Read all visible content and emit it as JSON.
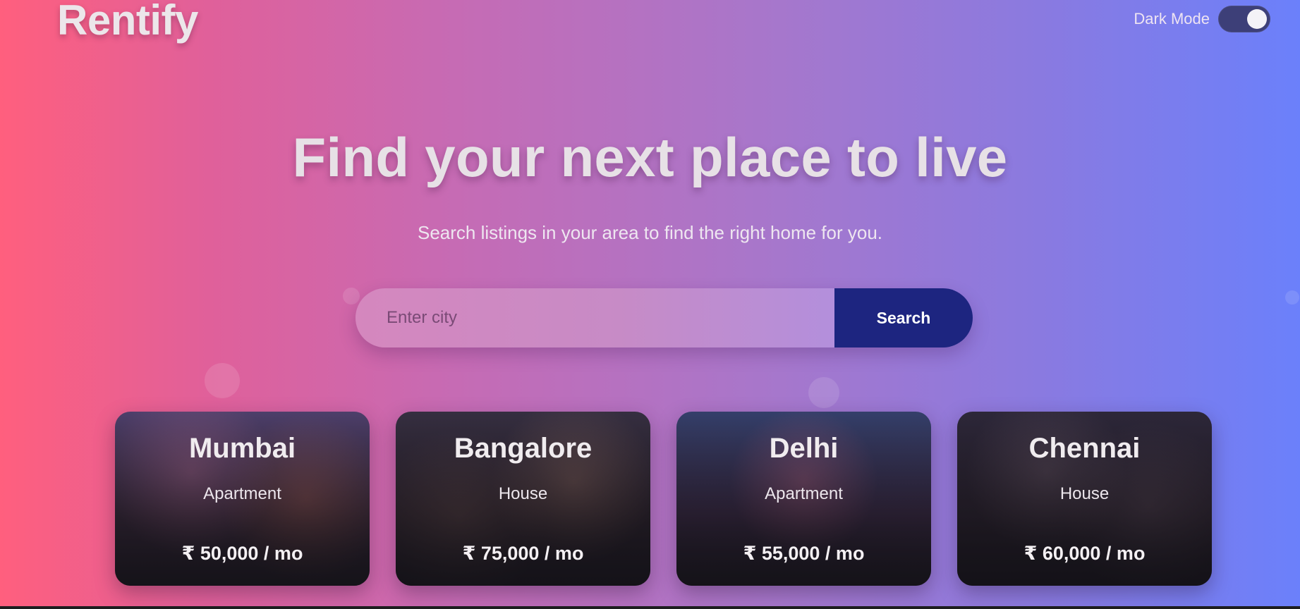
{
  "header": {
    "logo": "Rentify",
    "dark_mode_label": "Dark Mode",
    "dark_mode_on": true
  },
  "hero": {
    "title": "Find your next place to live",
    "subtitle": "Search listings in your area to find the right home for you."
  },
  "search": {
    "placeholder": "Enter city",
    "value": "",
    "button_label": "Search"
  },
  "listings": [
    {
      "city": "Mumbai",
      "type": "Apartment",
      "price": "₹ 50,000 / mo"
    },
    {
      "city": "Bangalore",
      "type": "House",
      "price": "₹ 75,000 / mo"
    },
    {
      "city": "Delhi",
      "type": "Apartment",
      "price": "₹ 55,000 / mo"
    },
    {
      "city": "Chennai",
      "type": "House",
      "price": "₹ 60,000 / mo"
    }
  ],
  "colors": {
    "gradient_start": "#ff5f7e",
    "gradient_end": "#6b80fb",
    "search_button": "#1d2580",
    "toggle_track": "#3d3f78"
  }
}
